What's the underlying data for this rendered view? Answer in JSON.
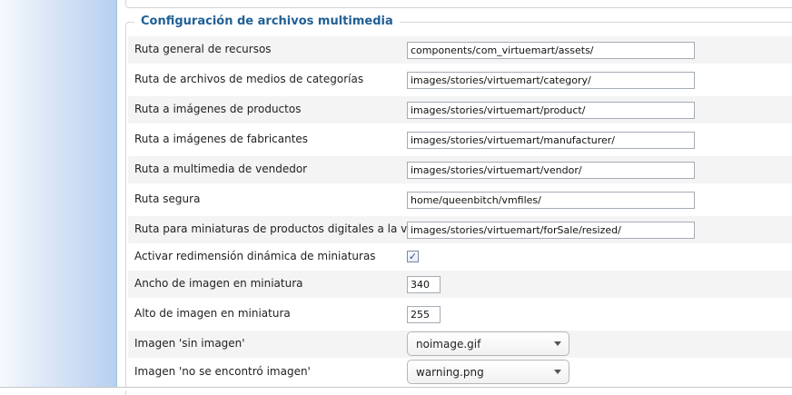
{
  "section": {
    "title": "Configuración de archivos multimedia"
  },
  "fields": [
    {
      "label": "Ruta general de recursos",
      "value": "components/com_virtuemart/assets/"
    },
    {
      "label": "Ruta de archivos de medios de categorías",
      "value": "images/stories/virtuemart/category/"
    },
    {
      "label": "Ruta a imágenes de productos",
      "value": "images/stories/virtuemart/product/"
    },
    {
      "label": "Ruta a imágenes de fabricantes",
      "value": "images/stories/virtuemart/manufacturer/"
    },
    {
      "label": "Ruta a multimedia de vendedor",
      "value": "images/stories/virtuemart/vendor/"
    },
    {
      "label": "Ruta segura",
      "value": "home/queenbitch/vmfiles/"
    },
    {
      "label": "Ruta para miniaturas de productos digitales a la venta",
      "value": "images/stories/virtuemart/forSale/resized/"
    }
  ],
  "dynamic_resize": {
    "label": "Activar redimensión dinámica de miniaturas",
    "checked": true,
    "check_glyph": "✓"
  },
  "thumb_width": {
    "label": "Ancho de imagen en miniatura",
    "value": "340"
  },
  "thumb_height": {
    "label": "Alto de imagen en miniatura",
    "value": "255"
  },
  "no_image": {
    "label": "Imagen 'sin imagen'",
    "selected": "noimage.gif"
  },
  "not_found_image": {
    "label": "Imagen 'no se encontró imagen'",
    "selected": "warning.png"
  },
  "colors": {
    "legend": "#1f5f95",
    "sidebar_gradient_end": "#b7d0f0",
    "row_alt": "#f4f4f4"
  },
  "icons": {
    "checkbox": "checkmark-icon",
    "select": "chevron-down-icon"
  }
}
